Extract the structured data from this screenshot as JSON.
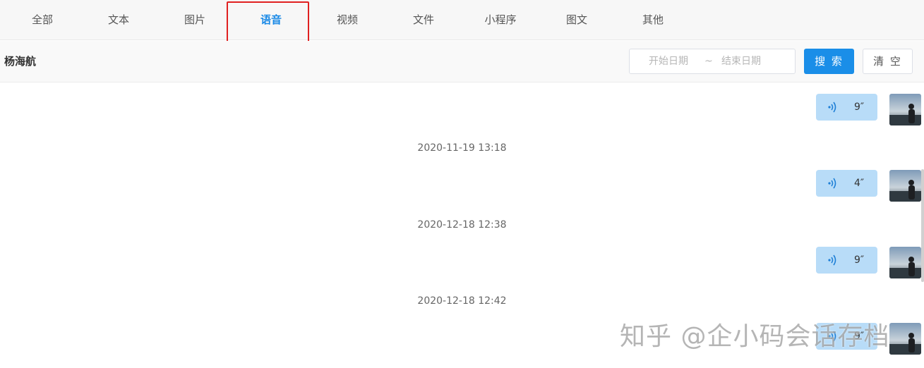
{
  "tabs": [
    {
      "label": "全部"
    },
    {
      "label": "文本"
    },
    {
      "label": "图片"
    },
    {
      "label": "语音",
      "active": true
    },
    {
      "label": "视频"
    },
    {
      "label": "文件"
    },
    {
      "label": "小程序"
    },
    {
      "label": "图文"
    },
    {
      "label": "其他"
    }
  ],
  "filter": {
    "contact_name": "杨海航",
    "start_placeholder": "开始日期",
    "separator": "~",
    "end_placeholder": "结束日期",
    "search_label": "搜 索",
    "clear_label": "清 空"
  },
  "messages": [
    {
      "duration": "9″"
    },
    {
      "timestamp": "2020-11-19 13:18",
      "duration": "4″"
    },
    {
      "timestamp": "2020-12-18 12:38",
      "duration": "9″"
    },
    {
      "timestamp": "2020-12-18 12:42",
      "duration": "9″"
    }
  ],
  "watermark": "知乎 @企小码会话存档",
  "colors": {
    "accent": "#1a8ee8",
    "active_tab": "#1989e6",
    "bubble": "#b8dcf8",
    "highlight": "#e02020"
  },
  "icons": {
    "voice": "voice-wave-icon",
    "avatar": "avatar-image"
  }
}
